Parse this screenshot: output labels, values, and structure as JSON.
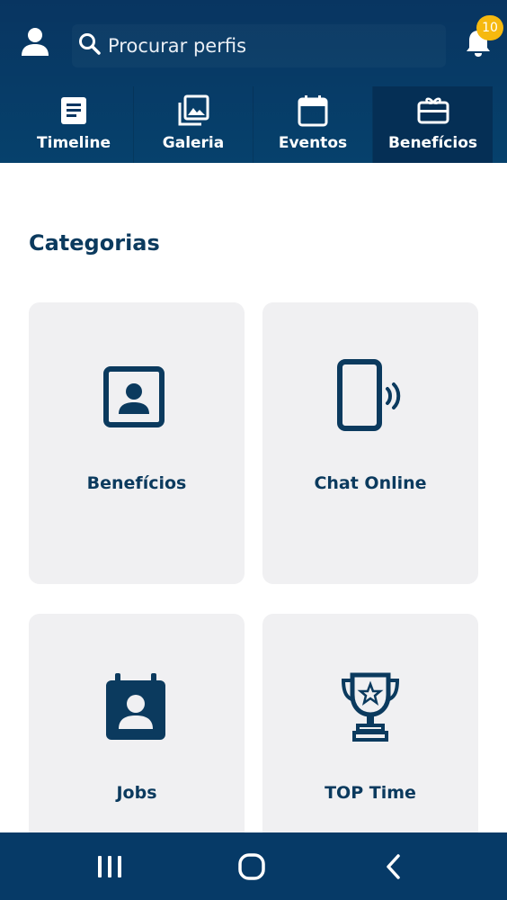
{
  "header": {
    "search": {
      "placeholder": "Procurar perfis",
      "value": ""
    },
    "notifications": {
      "count": "10"
    }
  },
  "tabs": [
    {
      "label": "Timeline",
      "icon": "article-icon",
      "active": false
    },
    {
      "label": "Galeria",
      "icon": "gallery-icon",
      "active": false
    },
    {
      "label": "Eventos",
      "icon": "calendar-icon",
      "active": false
    },
    {
      "label": "Benefícios",
      "icon": "gift-card-icon",
      "active": true
    }
  ],
  "main": {
    "title": "Categorias",
    "categories": [
      {
        "label": "Benefícios",
        "icon": "portrait-icon"
      },
      {
        "label": "Chat Online",
        "icon": "phone-ringing-icon"
      },
      {
        "label": "Jobs",
        "icon": "contact-calendar-icon"
      },
      {
        "label": "TOP Time",
        "icon": "trophy-icon"
      }
    ]
  },
  "colors": {
    "header_bg": "#083561",
    "accent_text": "#0b3a5e",
    "badge": "#f6b90f",
    "card_bg": "#f0f0f2",
    "navbar_bg": "#063a67"
  },
  "system_nav": {
    "buttons": [
      "recent-apps",
      "home",
      "back"
    ]
  }
}
